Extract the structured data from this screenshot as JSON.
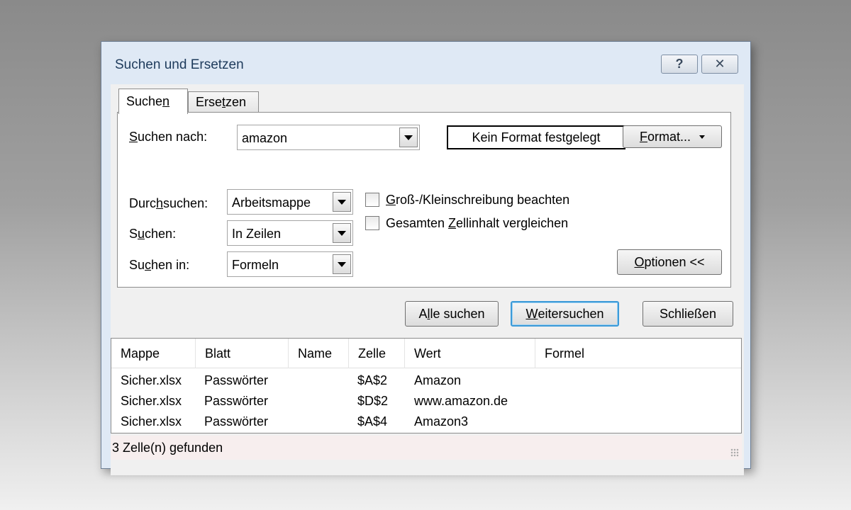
{
  "dialog": {
    "title": "Suchen und Ersetzen",
    "help_label": "?",
    "close_label": "✕"
  },
  "tabs": [
    {
      "pre": "Suche",
      "key": "n",
      "post": ""
    },
    {
      "pre": "Erse",
      "key": "t",
      "post": "zen"
    }
  ],
  "search": {
    "label_pre": "",
    "label_key": "S",
    "label_post": "uchen nach:",
    "value": "amazon",
    "format_status": "Kein Format festgelegt",
    "format_button_pre": "",
    "format_button_key": "F",
    "format_button_post": "ormat..."
  },
  "options": {
    "within": {
      "label_pre": "Durc",
      "label_key": "h",
      "label_post": "suchen:",
      "value": "Arbeitsmappe"
    },
    "direction": {
      "label_pre": "S",
      "label_key": "u",
      "label_post": "chen:",
      "value": "In Zeilen"
    },
    "look_in": {
      "label_pre": "Su",
      "label_key": "c",
      "label_post": "hen in:",
      "value": "Formeln"
    },
    "match_case": {
      "pre": "",
      "key": "G",
      "post": "roß-/Kleinschreibung beachten",
      "checked": false
    },
    "match_entire": {
      "pre": "Gesamten ",
      "key": "Z",
      "post": "ellinhalt vergleichen",
      "checked": false
    },
    "options_button_pre": "",
    "options_button_key": "O",
    "options_button_post": "ptionen <<"
  },
  "actions": {
    "find_all": {
      "pre": "A",
      "key": "l",
      "post": "le suchen"
    },
    "find_next": {
      "pre": "",
      "key": "W",
      "post": "eitersuchen"
    },
    "close": "Schließen"
  },
  "results": {
    "columns": [
      "Mappe",
      "Blatt",
      "Name",
      "Zelle",
      "Wert",
      "Formel"
    ],
    "rows": [
      {
        "mappe": "Sicher.xlsx",
        "blatt": "Passwörter",
        "name": "",
        "zelle": "$A$2",
        "wert": "Amazon",
        "formel": ""
      },
      {
        "mappe": "Sicher.xlsx",
        "blatt": "Passwörter",
        "name": "",
        "zelle": "$D$2",
        "wert": "www.amazon.de",
        "formel": ""
      },
      {
        "mappe": "Sicher.xlsx",
        "blatt": "Passwörter",
        "name": "",
        "zelle": "$A$4",
        "wert": "Amazon3",
        "formel": ""
      }
    ],
    "status": "3 Zelle(n) gefunden"
  }
}
